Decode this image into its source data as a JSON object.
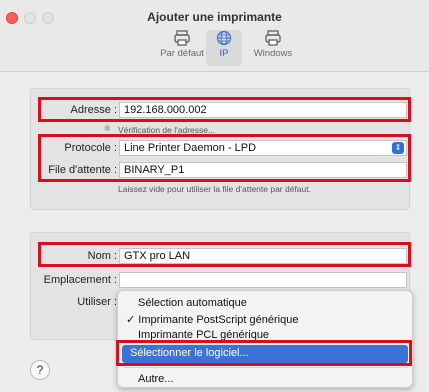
{
  "window": {
    "title": "Ajouter une imprimante"
  },
  "toolbar": {
    "default_label": "Par défaut",
    "ip_label": "IP",
    "windows_label": "Windows"
  },
  "form": {
    "address_label": "Adresse :",
    "address_value": "192.168.000.002",
    "verifying_text": "Vérification de l'adresse...",
    "protocol_label": "Protocole :",
    "protocol_value": "Line Printer Daemon - LPD",
    "queue_label": "File d'attente :",
    "queue_value": "BINARY_P1",
    "queue_hint": "Laissez vide pour utiliser la file d'attente par défaut.",
    "name_label": "Nom :",
    "name_value": "GTX pro LAN",
    "location_label": "Emplacement :",
    "use_label": "Utiliser :"
  },
  "use_menu": {
    "items": [
      "Sélection automatique",
      "✓ Imprimante PostScript générique",
      "Imprimante PCL générique",
      "Sélectionner le logiciel...",
      "Autre..."
    ]
  },
  "footer": {
    "help_label": "?"
  },
  "colors": {
    "highlight_red": "#d90e1c",
    "selection_blue": "#3b73d4",
    "accent_blue": "#2f6fd6"
  }
}
